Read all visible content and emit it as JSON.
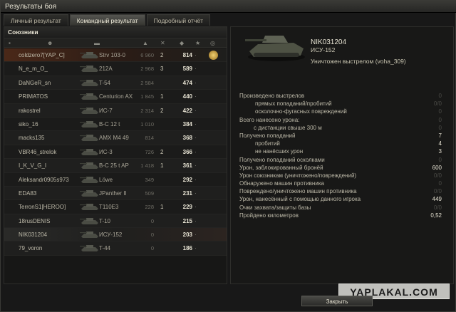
{
  "window": {
    "title": "Результаты боя"
  },
  "tabs": [
    {
      "label": "Личный результат",
      "active": false
    },
    {
      "label": "Командный результат",
      "active": true
    },
    {
      "label": "Подробный отчёт",
      "active": false
    }
  ],
  "team": {
    "heading": "Союзники",
    "players": [
      {
        "name": "coldzero7[YAP_C]",
        "tank": "Strv 103-0",
        "damage": "6 960",
        "kills": "2",
        "xp": "814",
        "medal": true
      },
      {
        "name": "N_e_m_O_",
        "tank": "212A",
        "damage": "2 968",
        "kills": "3",
        "xp": "589",
        "medal": false
      },
      {
        "name": "DaNGeR_sn",
        "tank": "T-54",
        "damage": "2 584",
        "kills": "",
        "xp": "474",
        "medal": false
      },
      {
        "name": "PRIMATOS",
        "tank": "Centurion AX",
        "damage": "1 845",
        "kills": "1",
        "xp": "440",
        "medal": false
      },
      {
        "name": "rakostrel",
        "tank": "ИС-7",
        "damage": "2 314",
        "kills": "2",
        "xp": "422",
        "medal": false
      },
      {
        "name": "siko_16",
        "tank": "B-C 12 t",
        "damage": "1 010",
        "kills": "",
        "xp": "384",
        "medal": false
      },
      {
        "name": "macks135",
        "tank": "AMX M4 49",
        "damage": "814",
        "kills": "",
        "xp": "368",
        "medal": false
      },
      {
        "name": "VBR46_strelok",
        "tank": "ИС-3",
        "damage": "726",
        "kills": "2",
        "xp": "366",
        "medal": false
      },
      {
        "name": "I_K_V_G_I",
        "tank": "B-C 25 t AP",
        "damage": "1 418",
        "kills": "1",
        "xp": "361",
        "medal": false
      },
      {
        "name": "Aleksandr0905s973",
        "tank": "Löwe",
        "damage": "349",
        "kills": "",
        "xp": "292",
        "medal": false
      },
      {
        "name": "EDA83",
        "tank": "JPanther II",
        "damage": "509",
        "kills": "",
        "xp": "231",
        "medal": false
      },
      {
        "name": "TerronS1[HEROO]",
        "tank": "T110E3",
        "damage": "228",
        "kills": "1",
        "xp": "229",
        "medal": false
      },
      {
        "name": "18rusDENIS",
        "tank": "T-10",
        "damage": "0",
        "kills": "",
        "xp": "215",
        "medal": false
      },
      {
        "name": "NIK031204",
        "tank": "ИСУ-152",
        "damage": "0",
        "kills": "",
        "xp": "203",
        "medal": false
      },
      {
        "name": "79_voron",
        "tank": "T-44",
        "damage": "0",
        "kills": "",
        "xp": "186",
        "medal": false
      }
    ]
  },
  "detail": {
    "player": "NIK031204",
    "tank": "ИСУ-152",
    "status": "Уничтожен выстрелом (voha_309)",
    "stats": [
      {
        "label": "Произведено выстрелов",
        "value": "0",
        "indent": 0,
        "dim": true
      },
      {
        "label": "прямых попаданий/пробитий",
        "value": "0/0",
        "indent": 2,
        "dim": true
      },
      {
        "label": "осколочно-фугасных повреждений",
        "value": "0",
        "indent": 2,
        "dim": true
      },
      {
        "label": "Всего нанесено урона:",
        "value": "0",
        "indent": 0,
        "dim": true
      },
      {
        "label": "с дистанции свыше 300 м",
        "value": "0",
        "indent": 1,
        "dim": true
      },
      {
        "label": "Получено попаданий",
        "value": "7",
        "indent": 0,
        "dim": false
      },
      {
        "label": "пробитий",
        "value": "4",
        "indent": 2,
        "dim": false
      },
      {
        "label": "не нанёсших урон",
        "value": "3",
        "indent": 2,
        "dim": false
      },
      {
        "label": "Получено попаданий осколками",
        "value": "0",
        "indent": 0,
        "dim": true
      },
      {
        "label": "Урон, заблокированный бронёй",
        "value": "600",
        "indent": 0,
        "dim": false
      },
      {
        "label": "Урон союзникам (уничтожено/повреждений)",
        "value": "0/0",
        "indent": 0,
        "dim": true
      },
      {
        "label": "Обнаружено машин противника",
        "value": "0",
        "indent": 0,
        "dim": true
      },
      {
        "label": "Повреждено/уничтожено машин противника",
        "value": "0/0",
        "indent": 0,
        "dim": true
      },
      {
        "label": "Урон, нанесённый с помощью данного игрока",
        "value": "449",
        "indent": 0,
        "dim": false
      },
      {
        "label": "Очки захвата/защиты базы",
        "value": "0/0",
        "indent": 0,
        "dim": true
      },
      {
        "label": "Пройдено километров",
        "value": "0,52",
        "indent": 0,
        "dim": false
      }
    ]
  },
  "buttons": {
    "close": "Закрыть"
  },
  "watermark": "YAPLAKAL.COM",
  "colors": {
    "highlight": "#4a2818",
    "accent": "#e8e4d4"
  }
}
